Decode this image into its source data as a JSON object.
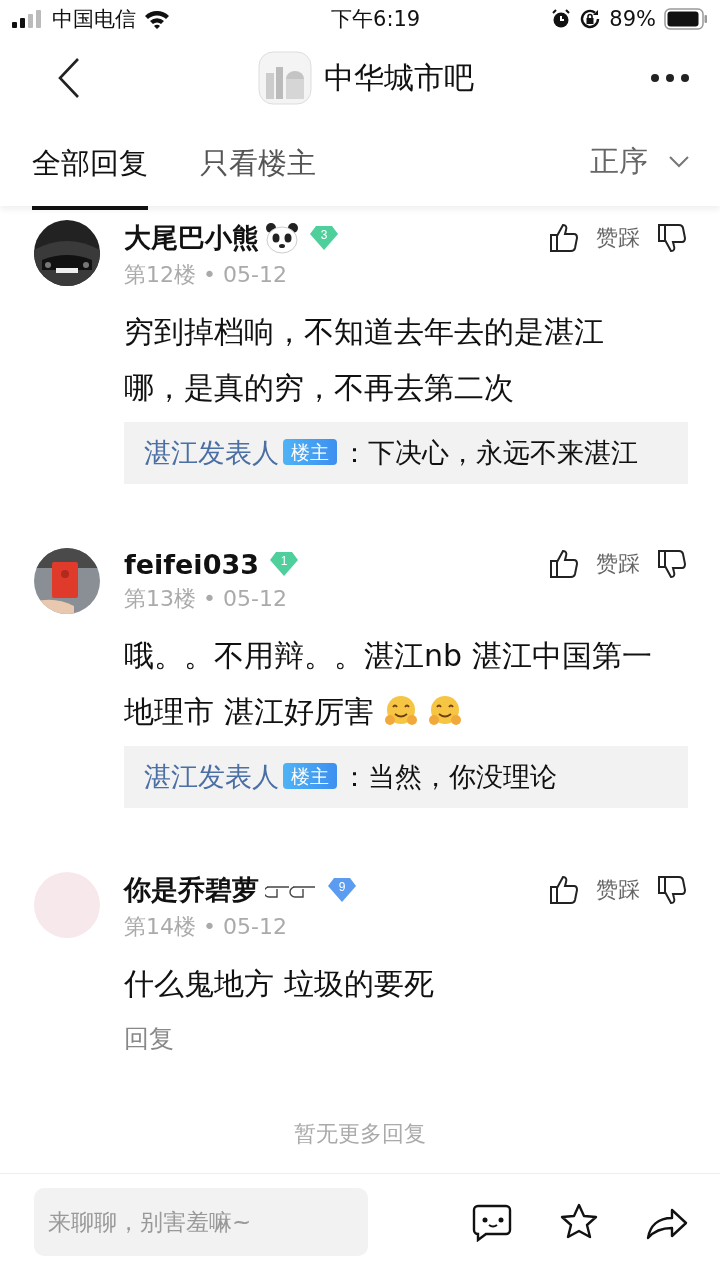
{
  "status_bar": {
    "carrier": "中国电信",
    "time": "下午6:19",
    "battery": "89%"
  },
  "header": {
    "title": "中华城市吧"
  },
  "tabs": [
    {
      "label": "全部回复",
      "selected": true
    },
    {
      "label": "只看楼主",
      "selected": false
    }
  ],
  "sort": {
    "label": "正序"
  },
  "comments": [
    {
      "name": "大尾巴小熊",
      "name_emoji": {
        "kind": "panda"
      },
      "avatar": {
        "kind": "picture"
      },
      "level": "3",
      "color": "#4fcf9c",
      "meta": "第12楼 • 05-12",
      "body": [
        {
          "kind": "text",
          "text": "穷到掉档响，不知道去年去的是湛江哪，是真的穷，不再去第二次"
        }
      ],
      "like_label": "赞踩",
      "replies": [
        {
          "author": "湛江发表人",
          "badge": "楼主",
          "text": "：下决心，永远不来湛江"
        }
      ]
    },
    {
      "name": "feifei033",
      "avatar": {
        "kind": "picture"
      },
      "level": "1",
      "color": "#4fcf9c",
      "meta": "第13楼 • 05-12",
      "body": [
        {
          "kind": "text",
          "text": "哦。。不用辩。。湛江nb 湛江中国第一地理市 湛江好厉害"
        },
        {
          "kind": "hug"
        },
        {
          "kind": "hug"
        }
      ],
      "like_label": "赞踩",
      "replies": [
        {
          "author": "湛江发表人",
          "badge": "楼主",
          "text": "：当然，你没理论"
        }
      ]
    },
    {
      "name": "你是乔碧萝",
      "name_emoji": {
        "kind": "hands"
      },
      "avatar": {
        "kind": "plain"
      },
      "level": "9",
      "color": "#5b9cf0",
      "meta": "第14楼 • 05-12",
      "body": [
        {
          "kind": "text",
          "text": "什么鬼地方 垃圾的要死"
        }
      ],
      "like_label": "赞踩",
      "reply_link": "回复"
    }
  ],
  "end_note": "暂无更多回复",
  "input": {
    "placeholder": "来聊聊，别害羞嘛~"
  }
}
